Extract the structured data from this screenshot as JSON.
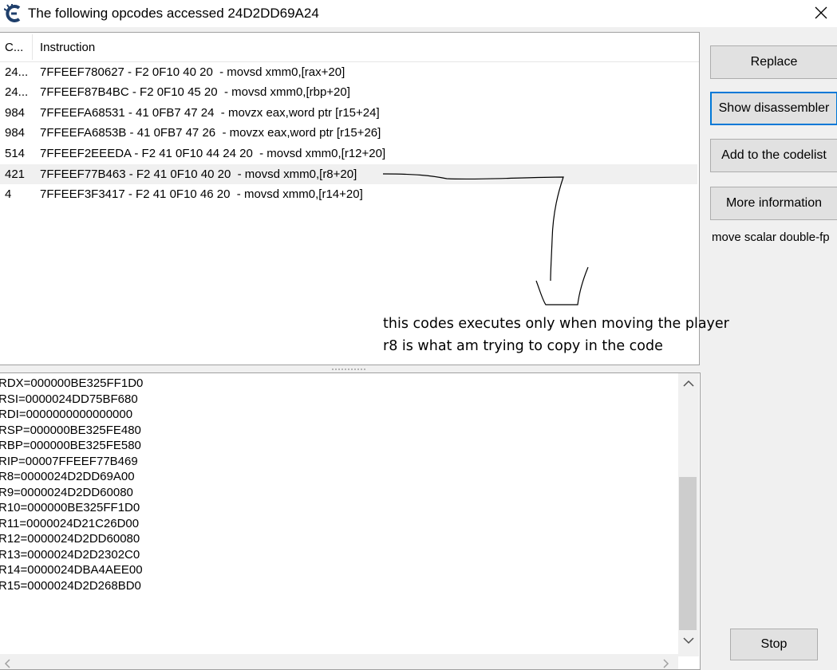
{
  "window": {
    "title": "The following opcodes accessed 24D2DD69A24",
    "app_icon": "cheat-engine-icon",
    "close_icon": "close-icon"
  },
  "list": {
    "headers": [
      "C...",
      "Instruction"
    ],
    "rows": [
      {
        "count": "24...",
        "instruction": "7FFEEF780627 - F2 0F10 40 20  - movsd xmm0,[rax+20]"
      },
      {
        "count": "24...",
        "instruction": "7FFEEF87B4BC - F2 0F10 45 20  - movsd xmm0,[rbp+20]"
      },
      {
        "count": "984",
        "instruction": "7FFEEFA68531 - 41 0FB7 47 24  - movzx eax,word ptr [r15+24]"
      },
      {
        "count": "984",
        "instruction": "7FFEEFA6853B - 41 0FB7 47 26  - movzx eax,word ptr [r15+26]"
      },
      {
        "count": "514",
        "instruction": "7FFEEF2EEEDA - F2 41 0F10 44 24 20  - movsd xmm0,[r12+20]"
      },
      {
        "count": "421",
        "instruction": "7FFEEF77B463 - F2 41 0F10 40 20  - movsd xmm0,[r8+20]"
      },
      {
        "count": "4",
        "instruction": "7FFEEF3F3417 - F2 41 0F10 46 20  - movsd xmm0,[r14+20]"
      }
    ]
  },
  "annotation": {
    "line1": "this codes executes only when moving the player",
    "line2": "r8 is what am trying to copy in the code"
  },
  "registers": [
    "RDX=000000BE325FF1D0",
    "RSI=0000024DD75BF680",
    "RDI=0000000000000000",
    "RSP=000000BE325FE480",
    "RBP=000000BE325FE580",
    "RIP=00007FFEEF77B469",
    "R8=0000024D2DD69A00",
    "R9=0000024D2DD60080",
    "R10=000000BE325FF1D0",
    "R11=0000024D21C26D00",
    "R12=0000024D2DD60080",
    "R13=0000024D2D2302C0",
    "R14=0000024DBA4AEE00",
    "R15=0000024D2D268BD0"
  ],
  "buttons": {
    "replace": "Replace",
    "show_disassembler": "Show disassembler",
    "add_to_codelist": "Add to the codelist",
    "more_information": "More information",
    "stop": "Stop"
  },
  "description": "move scalar double-fp",
  "colors": {
    "focus_border": "#0078d7",
    "selected_row": "#f0f0f0",
    "button_face": "#e1e1e1"
  }
}
